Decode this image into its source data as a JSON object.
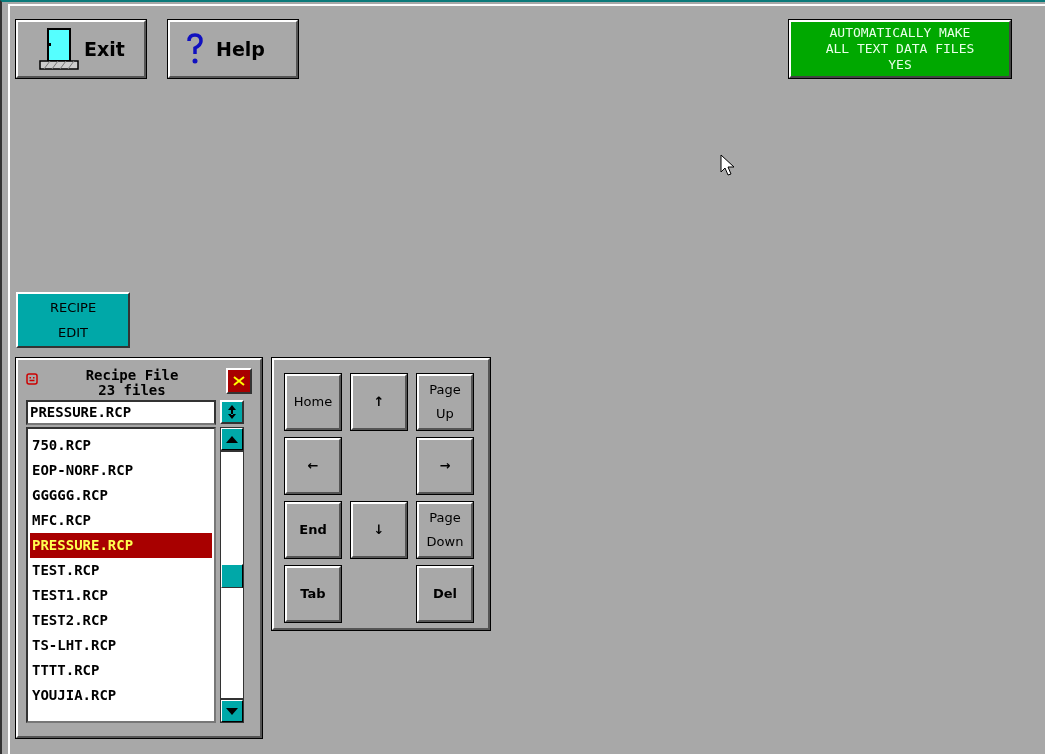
{
  "toolbar": {
    "exit_button": {
      "label": "Exit"
    },
    "help_button": {
      "label": "Help"
    }
  },
  "auto_text_button": {
    "lines": [
      "AUTOMATICALLY MAKE",
      "ALL TEXT DATA FILES",
      "YES"
    ]
  },
  "recipe_edit_button": {
    "lines": [
      "RECIPE",
      "EDIT"
    ]
  },
  "file_panel": {
    "title": "Recipe File",
    "count": "23 files",
    "current_file": "PRESSURE.RCP",
    "files": [
      {
        "name": "750.RCP",
        "selected": false
      },
      {
        "name": "EOP-NORF.RCP",
        "selected": false
      },
      {
        "name": "GGGGG.RCP",
        "selected": false
      },
      {
        "name": "MFC.RCP",
        "selected": false
      },
      {
        "name": "PRESSURE.RCP",
        "selected": true
      },
      {
        "name": "TEST.RCP",
        "selected": false
      },
      {
        "name": "TEST1.RCP",
        "selected": false
      },
      {
        "name": "TEST2.RCP",
        "selected": false
      },
      {
        "name": "TS-LHT.RCP",
        "selected": false
      },
      {
        "name": "TTTT.RCP",
        "selected": false
      },
      {
        "name": "YOUJIA.RCP",
        "selected": false
      }
    ]
  },
  "keypad": [
    {
      "kind": "plain",
      "lines": [
        "Home"
      ]
    },
    {
      "kind": "bold",
      "lines": [
        "↑"
      ]
    },
    {
      "kind": "plain",
      "lines": [
        "Page",
        "Up"
      ]
    },
    {
      "kind": "bold",
      "lines": [
        "←"
      ]
    },
    {
      "kind": "gap"
    },
    {
      "kind": "bold",
      "lines": [
        "→"
      ]
    },
    {
      "kind": "bold",
      "lines": [
        "End"
      ]
    },
    {
      "kind": "bold",
      "lines": [
        "↓"
      ]
    },
    {
      "kind": "plain",
      "lines": [
        "Page",
        "Down"
      ]
    },
    {
      "kind": "bold",
      "lines": [
        "Tab"
      ]
    },
    {
      "kind": "gap"
    },
    {
      "kind": "bold",
      "lines": [
        "Del"
      ]
    }
  ]
}
